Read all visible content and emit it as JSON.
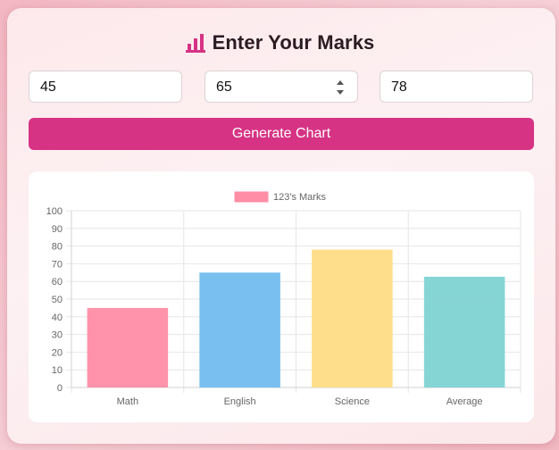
{
  "header": {
    "title": "Enter Your Marks",
    "icon": "bar-chart-icon",
    "icon_color": "#d63384"
  },
  "inputs": [
    {
      "name": "math",
      "value": "45"
    },
    {
      "name": "english",
      "value": "65"
    },
    {
      "name": "science",
      "value": "78"
    }
  ],
  "generate_button": {
    "label": "Generate Chart",
    "color": "#d63384"
  },
  "chart_data": {
    "type": "bar",
    "categories": [
      "Math",
      "English",
      "Science",
      "Average"
    ],
    "series": [
      {
        "name": "123's Marks",
        "values": [
          45,
          65,
          78,
          62.67
        ]
      }
    ],
    "bar_colors": [
      "#ff8da6",
      "#72bdf0",
      "#ffdc85",
      "#80d3d3"
    ],
    "yticks": [
      "0",
      "10",
      "20",
      "30",
      "40",
      "50",
      "60",
      "70",
      "80",
      "90",
      "100"
    ],
    "ylim": [
      0,
      100
    ],
    "grid": true,
    "legend": "top"
  }
}
